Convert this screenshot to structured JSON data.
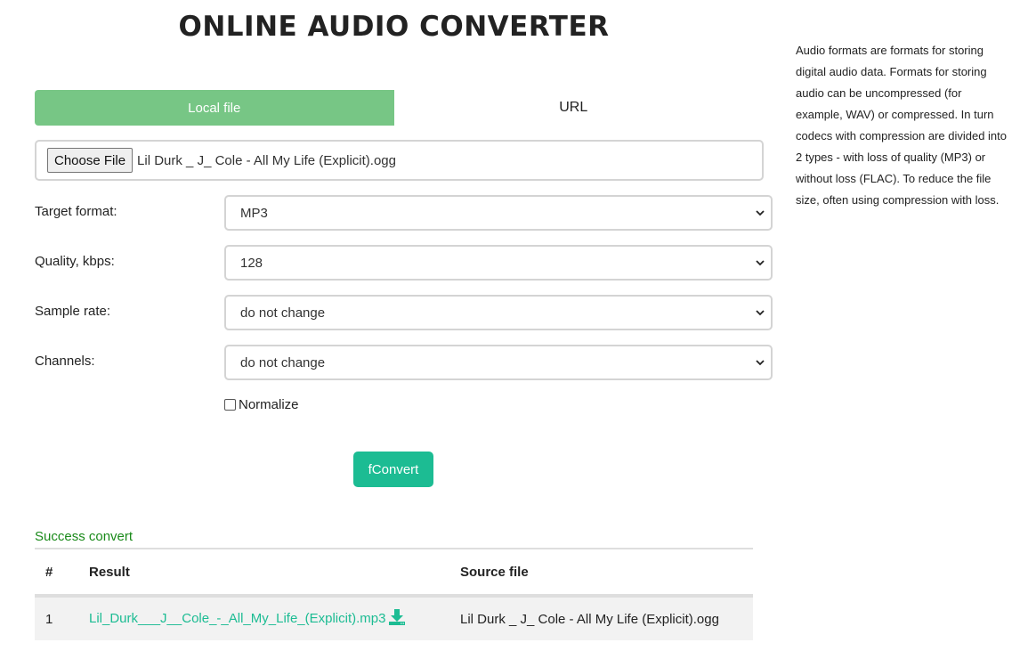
{
  "header": {
    "title": "ONLINE AUDIO CONVERTER"
  },
  "sidebar": {
    "description": "Audio formats are formats for storing digital audio data. Formats for storing audio can be uncompressed (for example, WAV) or compressed. In turn codecs with compression are divided into 2 types - with loss of quality (MP3) or without loss (FLAC). To reduce the file size, often using compression with loss."
  },
  "tabs": [
    {
      "label": "Local file",
      "active": true
    },
    {
      "label": "URL",
      "active": false
    }
  ],
  "file_input": {
    "button_label": "Choose File",
    "file_name": "Lil Durk _ J_ Cole - All My Life (Explicit).ogg"
  },
  "form": {
    "target_format": {
      "label": "Target format:",
      "value": "MP3"
    },
    "quality": {
      "label": "Quality, kbps:",
      "value": "128"
    },
    "sample_rate": {
      "label": "Sample rate:",
      "value": "do not change"
    },
    "channels": {
      "label": "Channels:",
      "value": "do not change"
    },
    "normalize": {
      "label": "Normalize",
      "checked": false
    }
  },
  "convert_button": {
    "label": "fConvert"
  },
  "result": {
    "status": "Success convert",
    "headers": [
      "#",
      "Result",
      "Source file"
    ],
    "rows": [
      {
        "num": "1",
        "result": "Lil_Durk___J__Cole_-_All_My_Life_(Explicit).mp3",
        "source": "Lil Durk _ J_ Cole - All My Life (Explicit).ogg"
      }
    ]
  },
  "colors": {
    "tab_active": "#77c685",
    "convert_button": "#1cbc93",
    "link": "#1cbc93",
    "success_text": "#1a8a1a"
  },
  "icons": {
    "select_arrow": "chevron-down-icon",
    "download": "download-icon"
  }
}
